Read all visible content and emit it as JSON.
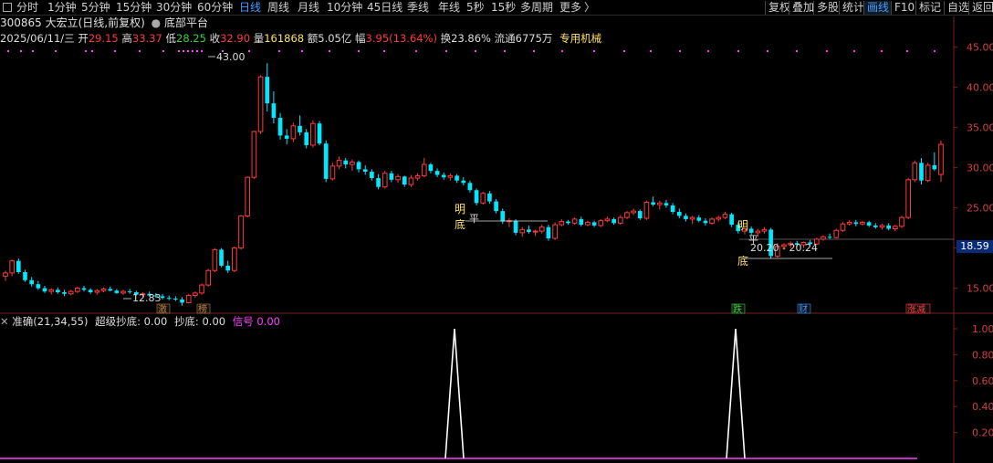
{
  "toolbar": {
    "periods": [
      "分时",
      "1分钟",
      "5分钟",
      "15分钟",
      "30分钟",
      "60分钟",
      "日线",
      "周线",
      "月线",
      "10分钟",
      "45日线",
      "季线",
      "年线",
      "5秒",
      "15秒",
      "多周期",
      "更多"
    ],
    "active_period": "日线",
    "more_arrow": "〉",
    "right_buttons": [
      "复权",
      "叠加",
      "多股",
      "统计",
      "画线",
      "F10",
      "标记",
      "自选",
      "返回"
    ],
    "active_button": "画线"
  },
  "stock": {
    "title": "300865 大宏立(日线,前复权)",
    "formula": "底部平台"
  },
  "quote": {
    "date": "2025/06/11/三",
    "open_label": "开",
    "open": "29.15",
    "high_label": "高",
    "high": "33.37",
    "low_label": "低",
    "low": "28.25",
    "close_label": "收",
    "close": "32.90",
    "volume_label": "量",
    "volume": "161868",
    "amount_label": "额",
    "amount": "5.05亿",
    "change_label": "幅",
    "change": "3.95(13.64%)",
    "turnover_label": "换",
    "turnover": "23.86%",
    "float_label": "流通",
    "float": "6775万",
    "sector": "专用机械"
  },
  "indicator": {
    "name": "准确(21,34,55)",
    "super_label": "超级抄底:",
    "super_value": "0.00",
    "bottom_label": "抄底:",
    "bottom_value": "0.00",
    "signal_label": "信号",
    "signal_value": "0.00"
  },
  "colors": {
    "up": "#ff3a3a",
    "down": "#00e8ff",
    "grid": "#7a1f1f",
    "axis_text": "#d04040",
    "yellow": "#ffe066",
    "magenta": "#ff40ff"
  },
  "price_axis": [
    "45.00",
    "40.00",
    "35.00",
    "30.00",
    "25.00",
    "20.00",
    "15.00"
  ],
  "indicator_axis": [
    "1.00",
    "0.80",
    "0.60",
    "0.40",
    "0.20"
  ],
  "current_price_tag": "18.59",
  "annotations": {
    "peak_high": "43.00",
    "early_low": "12.83",
    "range_label": "20.20 - 20.24",
    "ming1": "明",
    "ping1": "平",
    "di1": "底",
    "ming2": "明",
    "ping2": "平",
    "di2": "底"
  },
  "event_markers": [
    "激",
    "榜",
    "跌",
    "财",
    "涨减"
  ],
  "chart_data": {
    "type": "candlestick",
    "ylim": [
      12,
      47
    ],
    "indicator_ylim": [
      0,
      1
    ],
    "ohlc_trend": [
      [
        16.5,
        17.2,
        15.9,
        16.9
      ],
      [
        16.9,
        18.6,
        16.5,
        18.4
      ],
      [
        18.4,
        18.7,
        16.8,
        17.0
      ],
      [
        17.0,
        17.3,
        15.8,
        16.0
      ],
      [
        16.0,
        16.4,
        15.2,
        15.5
      ],
      [
        15.5,
        15.9,
        14.8,
        15.0
      ],
      [
        15.0,
        15.3,
        14.4,
        14.6
      ],
      [
        14.6,
        15.0,
        14.2,
        14.8
      ],
      [
        14.8,
        15.1,
        14.3,
        14.5
      ],
      [
        14.5,
        14.8,
        14.0,
        14.3
      ],
      [
        14.3,
        14.8,
        14.1,
        14.6
      ],
      [
        14.6,
        15.2,
        14.4,
        15.0
      ],
      [
        15.0,
        15.3,
        14.6,
        14.8
      ],
      [
        14.8,
        15.0,
        14.3,
        14.5
      ],
      [
        14.5,
        14.9,
        14.2,
        14.7
      ],
      [
        14.7,
        15.1,
        14.5,
        14.9
      ],
      [
        14.9,
        15.2,
        14.6,
        14.7
      ],
      [
        14.7,
        14.9,
        14.3,
        14.4
      ],
      [
        14.4,
        14.8,
        14.2,
        14.6
      ],
      [
        14.6,
        14.9,
        14.3,
        14.5
      ],
      [
        14.5,
        14.7,
        14.1,
        14.2
      ],
      [
        14.2,
        14.5,
        13.9,
        14.3
      ],
      [
        14.3,
        14.6,
        14.0,
        14.1
      ],
      [
        14.1,
        14.4,
        13.8,
        14.0
      ],
      [
        14.0,
        14.3,
        13.6,
        13.8
      ],
      [
        13.8,
        14.1,
        13.5,
        13.7
      ],
      [
        13.7,
        14.0,
        13.4,
        13.6
      ],
      [
        13.6,
        13.9,
        12.83,
        13.2
      ],
      [
        13.2,
        14.3,
        13.1,
        14.1
      ],
      [
        14.1,
        14.6,
        13.8,
        14.4
      ],
      [
        14.4,
        15.6,
        14.2,
        15.4
      ],
      [
        15.4,
        17.4,
        15.2,
        17.2
      ],
      [
        17.2,
        20.0,
        17.0,
        19.8
      ],
      [
        19.8,
        20.0,
        17.6,
        17.8
      ],
      [
        17.8,
        18.4,
        16.9,
        17.2
      ],
      [
        17.2,
        20.2,
        17.0,
        20.0
      ],
      [
        20.0,
        24.1,
        19.8,
        24.0
      ],
      [
        24.0,
        28.9,
        23.8,
        28.8
      ],
      [
        28.8,
        34.6,
        28.6,
        34.5
      ],
      [
        34.5,
        41.5,
        34.2,
        41.3
      ],
      [
        41.3,
        43.0,
        37.0,
        38.0
      ],
      [
        38.0,
        39.5,
        35.5,
        36.2
      ],
      [
        36.2,
        36.8,
        33.5,
        34.0
      ],
      [
        34.0,
        34.8,
        32.9,
        33.6
      ],
      [
        33.6,
        35.6,
        33.2,
        35.2
      ],
      [
        35.2,
        36.5,
        34.0,
        34.4
      ],
      [
        34.4,
        34.8,
        32.4,
        32.8
      ],
      [
        32.8,
        35.9,
        32.5,
        35.5
      ],
      [
        35.5,
        35.8,
        32.8,
        33.0
      ],
      [
        33.0,
        33.4,
        28.2,
        28.6
      ],
      [
        28.6,
        30.6,
        28.4,
        30.2
      ],
      [
        30.2,
        31.4,
        29.8,
        30.9
      ],
      [
        30.9,
        31.2,
        29.9,
        30.4
      ],
      [
        30.4,
        31.0,
        29.6,
        30.7
      ],
      [
        30.7,
        30.9,
        29.4,
        29.8
      ],
      [
        29.8,
        30.3,
        29.1,
        29.5
      ],
      [
        29.5,
        29.8,
        28.4,
        28.7
      ],
      [
        28.7,
        29.2,
        27.3,
        27.6
      ],
      [
        27.6,
        29.6,
        27.4,
        29.3
      ],
      [
        29.3,
        29.6,
        28.2,
        28.5
      ],
      [
        28.5,
        29.2,
        28.1,
        28.9
      ],
      [
        28.9,
        29.0,
        27.6,
        27.9
      ],
      [
        27.9,
        29.1,
        27.6,
        28.7
      ],
      [
        28.7,
        29.3,
        28.4,
        29.0
      ],
      [
        29.0,
        31.2,
        28.8,
        30.4
      ],
      [
        30.4,
        30.6,
        29.3,
        29.6
      ],
      [
        29.6,
        29.9,
        28.8,
        29.1
      ],
      [
        29.1,
        29.4,
        28.5,
        28.8
      ],
      [
        28.8,
        29.3,
        28.4,
        29.0
      ],
      [
        29.0,
        29.2,
        28.1,
        28.4
      ],
      [
        28.4,
        28.8,
        27.8,
        28.1
      ],
      [
        28.1,
        28.4,
        26.9,
        27.2
      ],
      [
        27.2,
        27.4,
        25.3,
        25.6
      ],
      [
        25.6,
        27.0,
        25.4,
        26.8
      ],
      [
        26.8,
        27.1,
        25.5,
        25.8
      ],
      [
        25.8,
        26.1,
        24.3,
        24.6
      ],
      [
        24.6,
        24.9,
        23.0,
        23.3
      ],
      [
        23.3,
        23.7,
        22.6,
        23.4
      ],
      [
        23.4,
        23.6,
        21.6,
        21.9
      ],
      [
        21.9,
        22.6,
        21.4,
        22.3
      ],
      [
        22.3,
        22.8,
        21.8,
        22.0
      ],
      [
        22.0,
        22.3,
        21.5,
        22.1
      ],
      [
        22.1,
        22.9,
        21.8,
        22.6
      ],
      [
        22.6,
        22.9,
        20.9,
        21.2
      ],
      [
        21.2,
        23.2,
        21.0,
        22.9
      ],
      [
        22.9,
        23.6,
        22.7,
        23.3
      ],
      [
        23.3,
        23.5,
        22.9,
        23.1
      ],
      [
        23.1,
        23.8,
        22.9,
        23.6
      ],
      [
        23.6,
        23.9,
        22.7,
        22.9
      ],
      [
        22.9,
        23.4,
        22.7,
        23.2
      ],
      [
        23.2,
        23.4,
        22.6,
        22.8
      ],
      [
        22.8,
        23.6,
        22.6,
        23.4
      ],
      [
        23.4,
        23.9,
        23.2,
        23.6
      ],
      [
        23.6,
        23.8,
        22.9,
        23.1
      ],
      [
        23.1,
        24.1,
        22.9,
        23.8
      ],
      [
        23.8,
        24.6,
        23.6,
        24.4
      ],
      [
        24.4,
        24.9,
        24.1,
        24.6
      ],
      [
        24.6,
        24.8,
        23.5,
        23.7
      ],
      [
        23.7,
        25.9,
        23.5,
        25.7
      ],
      [
        25.7,
        26.4,
        25.2,
        25.4
      ],
      [
        25.4,
        25.9,
        24.8,
        25.6
      ],
      [
        25.6,
        26.0,
        25.0,
        25.3
      ],
      [
        25.3,
        25.6,
        24.2,
        24.5
      ],
      [
        24.5,
        24.9,
        23.7,
        24.0
      ],
      [
        24.0,
        24.3,
        23.3,
        23.6
      ],
      [
        23.6,
        24.0,
        23.0,
        23.8
      ],
      [
        23.8,
        24.1,
        23.2,
        23.4
      ],
      [
        23.4,
        23.7,
        22.8,
        23.1
      ],
      [
        23.1,
        23.8,
        22.9,
        23.6
      ],
      [
        23.6,
        24.0,
        23.3,
        23.8
      ],
      [
        23.8,
        24.5,
        23.6,
        24.2
      ],
      [
        24.2,
        24.4,
        22.6,
        22.9
      ],
      [
        22.9,
        23.2,
        21.8,
        22.1
      ],
      [
        22.1,
        22.6,
        21.7,
        22.4
      ],
      [
        22.4,
        22.7,
        21.6,
        21.9
      ],
      [
        21.9,
        22.4,
        21.4,
        22.1
      ],
      [
        22.1,
        22.6,
        21.8,
        22.3
      ],
      [
        22.3,
        22.5,
        18.7,
        19.0
      ],
      [
        19.0,
        20.6,
        18.8,
        20.2
      ],
      [
        20.2,
        20.6,
        19.8,
        20.4
      ],
      [
        20.4,
        20.8,
        20.0,
        20.6
      ],
      [
        20.6,
        20.9,
        20.2,
        20.4
      ],
      [
        20.4,
        20.8,
        20.0,
        20.7
      ],
      [
        20.7,
        21.0,
        20.3,
        20.5
      ],
      [
        20.5,
        21.3,
        20.4,
        21.1
      ],
      [
        21.1,
        21.6,
        20.9,
        21.4
      ],
      [
        21.4,
        21.8,
        21.1,
        21.3
      ],
      [
        21.3,
        22.4,
        21.2,
        22.2
      ],
      [
        22.2,
        23.2,
        22.0,
        23.0
      ],
      [
        23.0,
        23.5,
        22.8,
        23.2
      ],
      [
        23.2,
        23.5,
        22.7,
        23.0
      ],
      [
        23.0,
        23.4,
        22.8,
        23.2
      ],
      [
        23.2,
        23.4,
        22.6,
        22.8
      ],
      [
        22.8,
        23.1,
        22.4,
        22.6
      ],
      [
        22.6,
        23.0,
        22.3,
        22.8
      ],
      [
        22.8,
        23.1,
        22.2,
        22.4
      ],
      [
        22.4,
        22.9,
        22.1,
        22.7
      ],
      [
        22.7,
        24.0,
        22.5,
        23.8
      ],
      [
        23.8,
        28.7,
        23.6,
        28.5
      ],
      [
        28.5,
        30.9,
        28.2,
        30.6
      ],
      [
        30.6,
        31.2,
        27.9,
        28.4
      ],
      [
        28.4,
        30.6,
        28.2,
        30.3
      ],
      [
        30.3,
        31.9,
        29.6,
        29.8
      ],
      [
        29.15,
        33.37,
        28.25,
        32.9
      ]
    ],
    "indicator_spikes": [
      0.46,
      0.74
    ]
  }
}
